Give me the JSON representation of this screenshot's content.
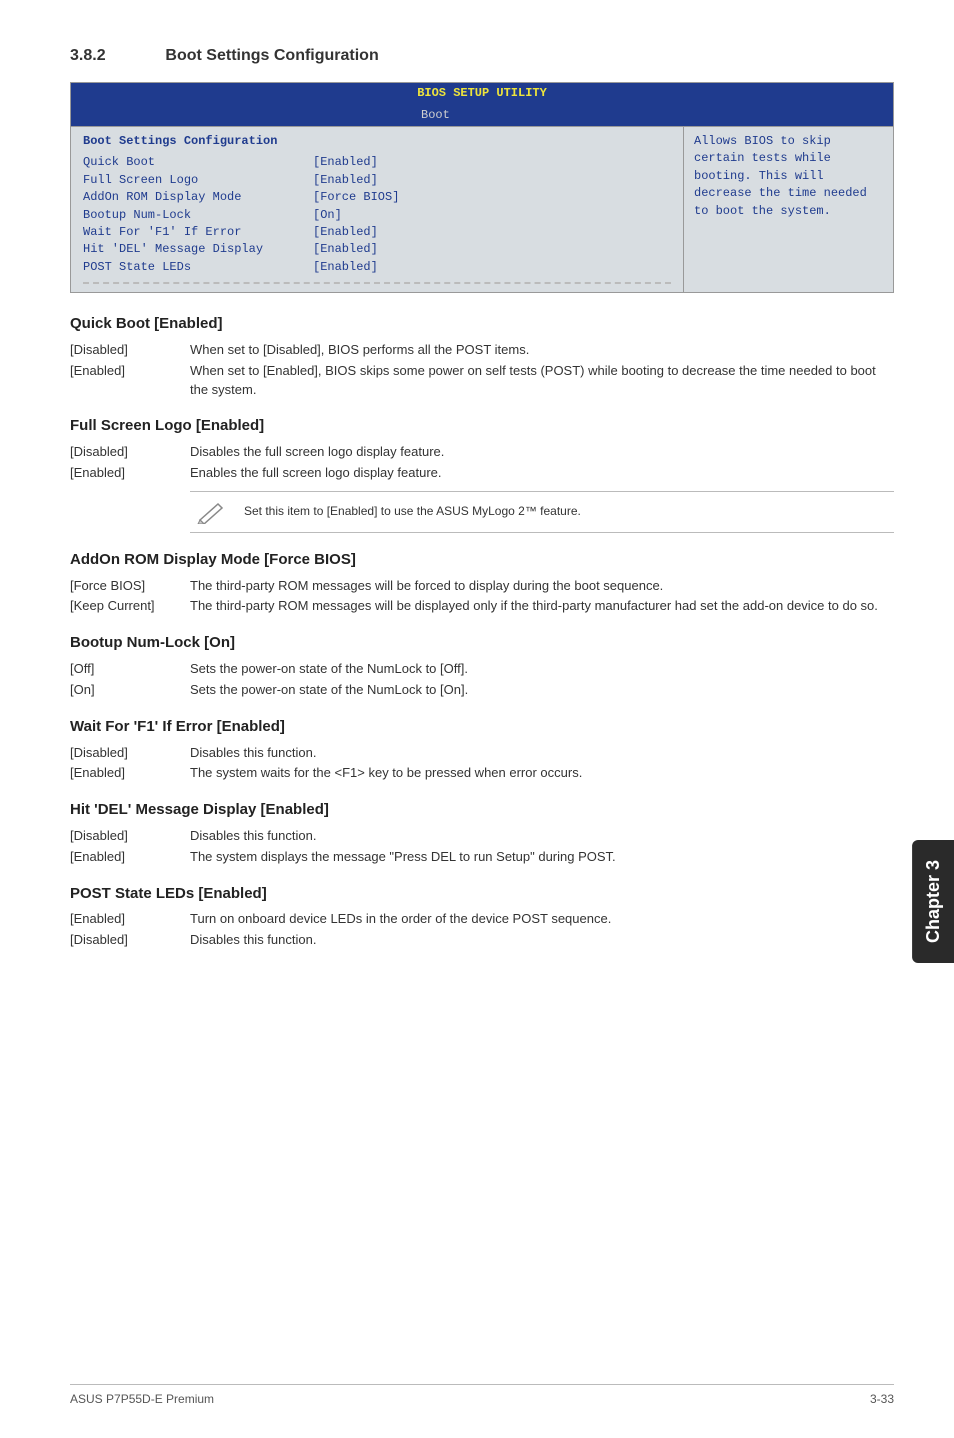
{
  "section": {
    "number": "3.8.2",
    "title": "Boot Settings Configuration"
  },
  "bios": {
    "title": "BIOS SETUP UTILITY",
    "tab": "Boot",
    "panel_heading": "Boot Settings Configuration",
    "rows": [
      {
        "label": "Quick Boot",
        "value": "[Enabled]"
      },
      {
        "label": "Full Screen Logo",
        "value": "[Enabled]"
      },
      {
        "label": "AddOn ROM Display Mode",
        "value": "[Force BIOS]"
      },
      {
        "label": "Bootup Num-Lock",
        "value": "[On]"
      },
      {
        "label": "Wait For 'F1' If Error",
        "value": "[Enabled]"
      },
      {
        "label": "Hit 'DEL' Message Display",
        "value": "[Enabled]"
      },
      {
        "label": "POST State LEDs",
        "value": "[Enabled]"
      }
    ],
    "help": "Allows BIOS to skip certain tests while booting. This will decrease the time needed to boot the system."
  },
  "settings": [
    {
      "title": "Quick Boot [Enabled]",
      "options": [
        {
          "key": "[Disabled]",
          "desc": "When set to [Disabled], BIOS performs all the POST items."
        },
        {
          "key": "[Enabled]",
          "desc": "When set to [Enabled], BIOS skips some power on self tests (POST) while booting to decrease the time needed to boot the system."
        }
      ]
    },
    {
      "title": "Full Screen Logo [Enabled]",
      "options": [
        {
          "key": "[Disabled]",
          "desc": "Disables the full screen logo display feature."
        },
        {
          "key": "[Enabled]",
          "desc": "Enables the full screen logo display feature."
        }
      ],
      "note": "Set this item to [Enabled] to use the ASUS MyLogo 2™ feature."
    },
    {
      "title": "AddOn ROM Display Mode [Force BIOS]",
      "options": [
        {
          "key": "[Force BIOS]",
          "desc": "The third-party ROM messages will be forced to display during the boot sequence."
        },
        {
          "key": "[Keep Current]",
          "desc": "The third-party ROM messages will be displayed only if the third-party manufacturer had set the add-on device to do so."
        }
      ]
    },
    {
      "title": "Bootup Num-Lock [On]",
      "options": [
        {
          "key": "[Off]",
          "desc": "Sets the power-on state of the NumLock to [Off]."
        },
        {
          "key": "[On]",
          "desc": "Sets the power-on state of the NumLock to [On]."
        }
      ]
    },
    {
      "title": "Wait For 'F1' If Error [Enabled]",
      "options": [
        {
          "key": "[Disabled]",
          "desc": "Disables this function."
        },
        {
          "key": "[Enabled]",
          "desc": "The system waits for the <F1> key to be pressed when error occurs."
        }
      ]
    },
    {
      "title": "Hit 'DEL' Message Display [Enabled]",
      "options": [
        {
          "key": "[Disabled]",
          "desc": "Disables this function."
        },
        {
          "key": "[Enabled]",
          "desc": "The system displays the message \"Press DEL to run Setup\" during POST."
        }
      ]
    },
    {
      "title": "POST State LEDs [Enabled]",
      "options": [
        {
          "key": "[Enabled]",
          "desc": "Turn on onboard device LEDs in the order of the device POST sequence."
        },
        {
          "key": "[Disabled]",
          "desc": "Disables this function."
        }
      ]
    }
  ],
  "sidebar": "Chapter 3",
  "footer": {
    "left": "ASUS P7P55D-E Premium",
    "right": "3-33"
  }
}
